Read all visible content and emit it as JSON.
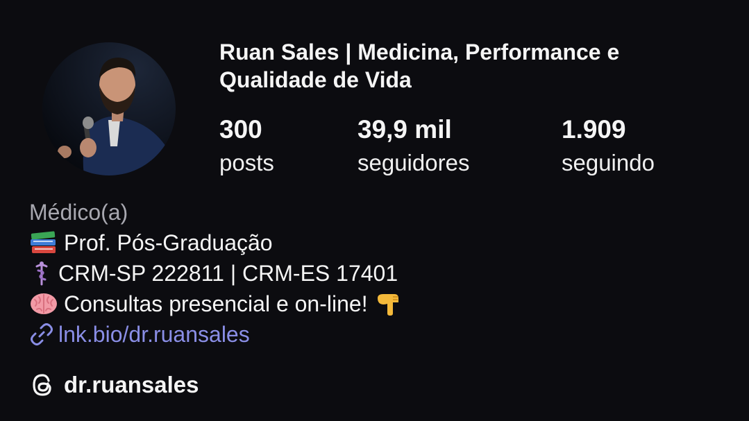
{
  "profile": {
    "name": "Ruan Sales | Medicina, Performance e Qualidade de Vida",
    "avatar_icon": "person-with-microphone-photo"
  },
  "stats": {
    "posts": {
      "value": "300",
      "label": "posts"
    },
    "followers": {
      "value": "39,9 mil",
      "label": "seguidores"
    },
    "following": {
      "value": "1.909",
      "label": "seguindo"
    }
  },
  "bio": {
    "category": "Médico(a)",
    "lines": [
      {
        "icon": "books-icon",
        "text": "Prof. Pós-Graduação"
      },
      {
        "icon": "medical-symbol-icon",
        "text": "CRM-SP 222811 | CRM-ES 17401"
      },
      {
        "icon": "brain-icon",
        "text": "Consultas presencial e on-line!",
        "trailing_icon": "pointing-down-hand-icon"
      }
    ],
    "link": {
      "icon": "link-icon",
      "text": "lnk.bio/dr.ruansales"
    }
  },
  "threads": {
    "icon": "threads-icon",
    "handle": "dr.ruansales"
  },
  "colors": {
    "background": "#0c0c10",
    "text": "#f5f5f5",
    "category": "#a8a8b0",
    "link": "#8a8ee6"
  }
}
